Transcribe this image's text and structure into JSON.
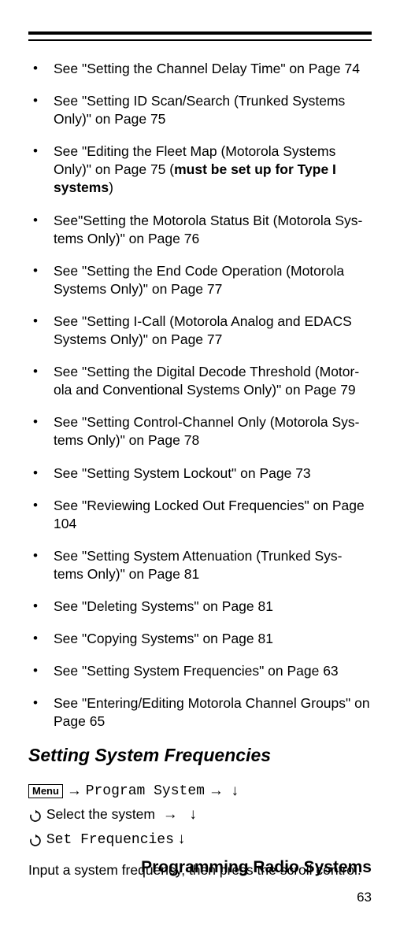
{
  "bullets": [
    {
      "pre": "See \"Setting the Channel Delay Time\" on Page 74"
    },
    {
      "pre": "See \"Setting ID Scan/Search (Trunked Systems Only)\" on Page 75"
    },
    {
      "pre": "See \"Editing the Fleet Map (Motorola Systems Only)\" on Page 75 (",
      "bold": "must be set up for Type I systems",
      "post": ")"
    },
    {
      "pre": "See\"Setting the Motorola Status Bit (Motorola Sys-tems Only)\" on Page 76"
    },
    {
      "pre": "See \"Setting the End Code Operation (Motorola Systems Only)\" on Page 77"
    },
    {
      "pre": "See \"Setting I-Call (Motorola Analog and EDACS Systems Only)\" on Page 77"
    },
    {
      "pre": "See \"Setting the Digital Decode Threshold (Motor-ola and Conventional Systems Only)\" on Page 79"
    },
    {
      "pre": "See \"Setting Control-Channel Only (Motorola Sys-tems Only)\" on Page 78"
    },
    {
      "pre": "See \"Setting System Lockout\" on Page 73"
    },
    {
      "pre": "See \"Reviewing Locked Out Frequencies\" on Page 104"
    },
    {
      "pre": "See \"Setting System Attenuation (Trunked Sys-tems Only)\" on Page 81"
    },
    {
      "pre": "See \"Deleting Systems\" on Page 81"
    },
    {
      "pre": "See \"Copying Systems\" on Page 81"
    },
    {
      "pre": "See \"Setting System Frequencies\" on Page 63"
    },
    {
      "pre": "See \"Entering/Editing Motorola Channel Groups\" on Page 65"
    }
  ],
  "section_heading": "Setting System Frequencies",
  "steps": {
    "menu_label": "Menu",
    "arrow_right": "→",
    "arrow_down": "↓",
    "program_system": "Program System",
    "select_system": "Select the system",
    "set_frequencies": "Set Frequencies"
  },
  "body_text": "Input a system frequency, then press the scroll control.",
  "footer_title": "Programming Radio Systems",
  "page_number": "63"
}
